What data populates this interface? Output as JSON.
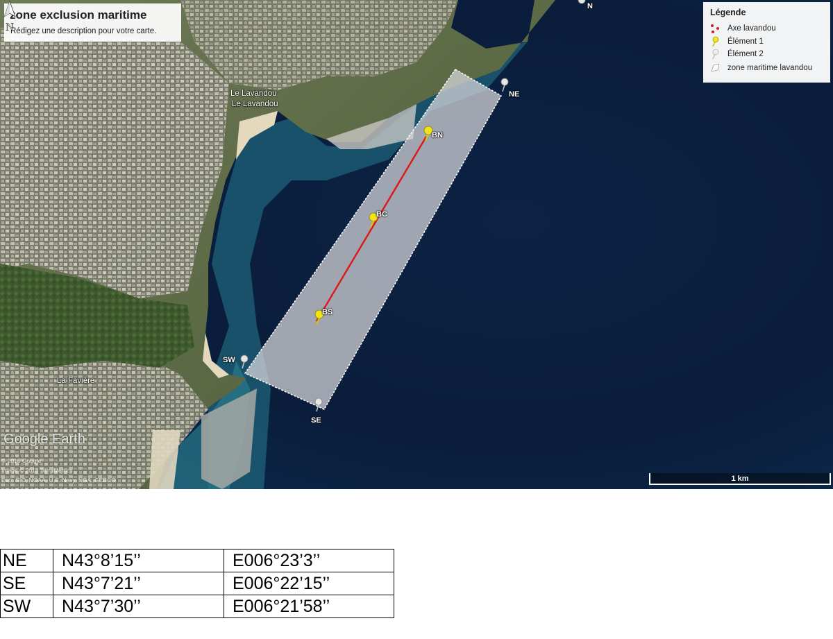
{
  "map": {
    "title": "zone exclusion maritime",
    "description": "Rédigez une description pour votre carte.",
    "legend": {
      "title": "Légende",
      "items": [
        {
          "label": "Axe lavandou",
          "icon": "path-icon",
          "color": "#cc2222"
        },
        {
          "label": "Élément 1",
          "icon": "yellow-pushpin-icon",
          "color": "#f2e21a"
        },
        {
          "label": "Élément 2",
          "icon": "white-pushpin-icon",
          "color": "#e8e8e8"
        },
        {
          "label": "zone maritime lavandou",
          "icon": "polygon-icon",
          "color": "#ffffff"
        }
      ]
    },
    "markers": {
      "ne": "NE",
      "se": "SE",
      "sw": "SW",
      "bn": "BN",
      "bc": "BC",
      "bs": "BS",
      "n": "N"
    },
    "places": {
      "lavandou_1": "Le Lavandou",
      "lavandou_2": "Le Lavandou",
      "faviere": "La Favière"
    },
    "attribution": {
      "logo": "Google Earth",
      "line1": "© 2018 Google",
      "line2": "Image © 2018 TerraMetrics",
      "line3": "Data SIO, NOAA, U.S. Navy, NGA, GEBCO"
    },
    "scale": "1 km",
    "compass_letter": "N",
    "colors": {
      "axis_line": "#dd1a1a",
      "zone_fill": "#d9d9dc",
      "sea_deep": "#0b1e3a",
      "sea_shallow": "#1f6f86"
    }
  },
  "coordinates_table": [
    [
      "NE",
      "N43°8’15’’",
      "E006°23’3’’"
    ],
    [
      "SE",
      "N43°7’21’’",
      "E006°22’15’’"
    ],
    [
      "SW",
      "N43°7’30’’",
      "E006°21’58’’"
    ]
  ]
}
